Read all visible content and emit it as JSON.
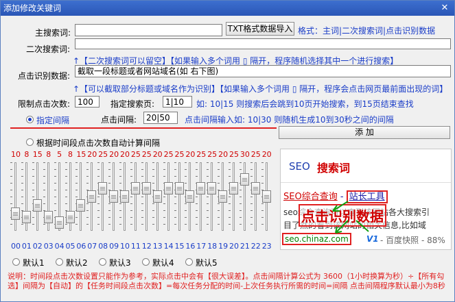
{
  "window": {
    "title": "添加修改关键词",
    "close_glyph": "✕"
  },
  "main_keyword": {
    "label": "主搜索词:",
    "value": ""
  },
  "txt_import_button": "TXT格式数据导入",
  "format_hint": "格式：主词|二次搜索词|点击识别数据",
  "secondary_keyword": {
    "label": "二次搜索词:",
    "value": ""
  },
  "secondary_hint": "↑【二次搜索词可以留空】【如果输入多个词用  ▯  隔开，程序随机选择其中一个进行搜索】",
  "click_data": {
    "label": "点击识别数据:",
    "value": "截取一段标题或者网站域名(如 右下图)"
  },
  "click_hint": "↑【可以截取部分标题或域名作为识别】【如果输入多个词用  ▯  隔开，程序会点击网页最前面出现的词】",
  "click_limit": {
    "label": "限制点击次数:",
    "value": "100"
  },
  "search_pages": {
    "label": "指定搜索页:",
    "value": "1|10"
  },
  "search_pages_hint": "如:  10|15 则搜索后会跳到10页开始搜索，到15页结束查找",
  "interval_radio": {
    "label": "指定间隔",
    "checked": true
  },
  "click_interval": {
    "label": "点击间隔:",
    "value": "20|50"
  },
  "interval_hint": "点击间隔输入如:   10|30  则随机生成10到30秒之间的间隔",
  "add_button": "添  加",
  "auto_radio": {
    "label": "根据时间段点击次数自动计算间隔",
    "checked": false
  },
  "hours": [
    {
      "label": "00",
      "value": "10"
    },
    {
      "label": "01",
      "value": "8"
    },
    {
      "label": "02",
      "value": "15"
    },
    {
      "label": "03",
      "value": "8"
    },
    {
      "label": "04",
      "value": "5"
    },
    {
      "label": "05",
      "value": "8"
    },
    {
      "label": "06",
      "value": "15"
    },
    {
      "label": "07",
      "value": "20"
    },
    {
      "label": "08",
      "value": "25"
    },
    {
      "label": "09",
      "value": "20"
    },
    {
      "label": "10",
      "value": "20"
    },
    {
      "label": "11",
      "value": "25"
    },
    {
      "label": "12",
      "value": "25"
    },
    {
      "label": "13",
      "value": "20"
    },
    {
      "label": "14",
      "value": "25"
    },
    {
      "label": "15",
      "value": "25"
    },
    {
      "label": "16",
      "value": "20"
    },
    {
      "label": "17",
      "value": "25"
    },
    {
      "label": "18",
      "value": "25"
    },
    {
      "label": "19",
      "value": "20"
    },
    {
      "label": "20",
      "value": "25"
    },
    {
      "label": "21",
      "value": "30"
    },
    {
      "label": "22",
      "value": "25"
    },
    {
      "label": "23",
      "value": "20"
    }
  ],
  "slider_max": 40,
  "presets": [
    "默认1",
    "默认2",
    "默认3",
    "默认4",
    "默认5"
  ],
  "preview": {
    "seo_label": "SEO",
    "title": "搜索词",
    "result_title_a": "SEO综合查询",
    "result_title_sep": " - ",
    "result_title_b": "站长工具",
    "snippet_1": "seo综合查询可以查到该网站各大搜索引",
    "snippet_2": "目了然的看到该网站的相关信息,比如域",
    "url": "seo.chinaz.com",
    "snapshot": "- 百度快照 - 88%",
    "overlay": "点击识别数据",
    "v_badge": "V1"
  },
  "note": "说明：时间段点击次数设置只能作为参考，实际点击中会有【很大误差】。点击间隔计算公式为 3600（1小时换算为秒）÷【所有勾选】间隔为【自动】的【任务时间段点击次数】=每次任务分配的时间-上次任务执行所需的时间=间隔 点击间隔程序默认最小为8秒"
}
